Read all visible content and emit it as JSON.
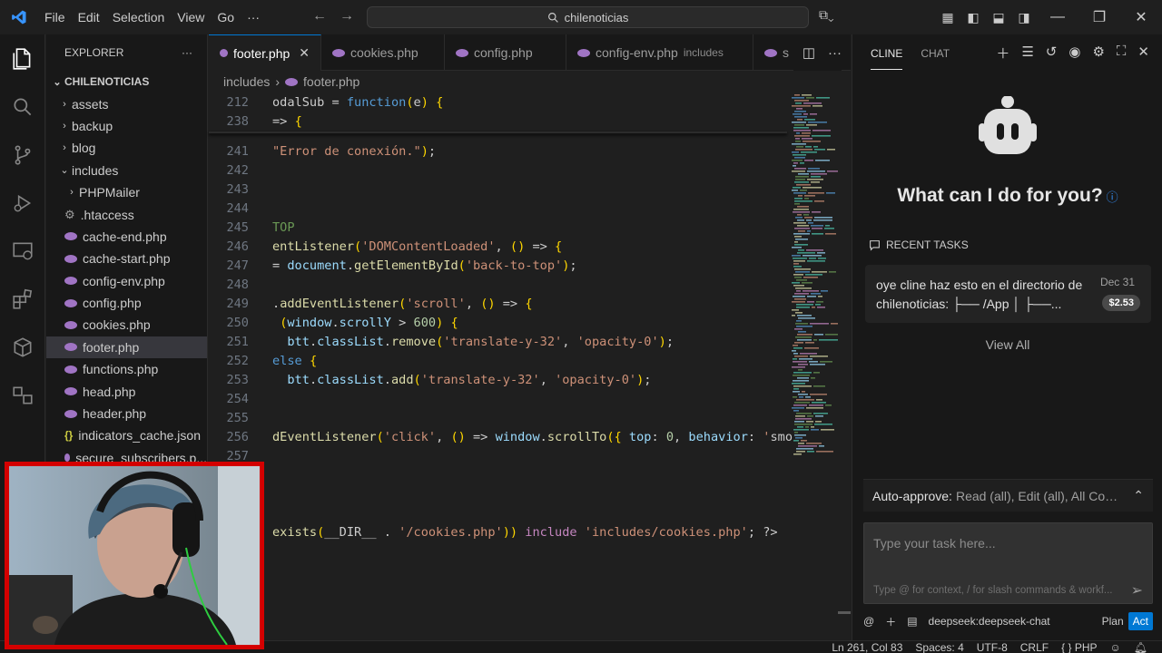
{
  "titlebar": {
    "menu": [
      "File",
      "Edit",
      "Selection",
      "View",
      "Go",
      "···"
    ],
    "search_text": "chilenoticias"
  },
  "explorer": {
    "title": "EXPLORER",
    "more": "···",
    "root": "CHILENOTICIAS",
    "items": [
      {
        "label": "assets",
        "type": "folder",
        "depth": 1,
        "open": false
      },
      {
        "label": "backup",
        "type": "folder",
        "depth": 1,
        "open": false
      },
      {
        "label": "blog",
        "type": "folder",
        "depth": 1,
        "open": false
      },
      {
        "label": "includes",
        "type": "folder",
        "depth": 1,
        "open": true
      },
      {
        "label": "PHPMailer",
        "type": "folder",
        "depth": 2,
        "open": false
      },
      {
        "label": ".htaccess",
        "type": "gear",
        "depth": 2
      },
      {
        "label": "cache-end.php",
        "type": "php",
        "depth": 2
      },
      {
        "label": "cache-start.php",
        "type": "php",
        "depth": 2
      },
      {
        "label": "config-env.php",
        "type": "php",
        "depth": 2
      },
      {
        "label": "config.php",
        "type": "php",
        "depth": 2
      },
      {
        "label": "cookies.php",
        "type": "php",
        "depth": 2
      },
      {
        "label": "footer.php",
        "type": "php",
        "depth": 2,
        "active": true
      },
      {
        "label": "functions.php",
        "type": "php",
        "depth": 2
      },
      {
        "label": "head.php",
        "type": "php",
        "depth": 2
      },
      {
        "label": "header.php",
        "type": "php",
        "depth": 2
      },
      {
        "label": "indicators_cache.json",
        "type": "json",
        "depth": 2
      },
      {
        "label": "secure_subscribers.p...",
        "type": "php",
        "depth": 2
      }
    ]
  },
  "editor": {
    "tabs": [
      {
        "label": "footer.php",
        "hint": "",
        "active": true,
        "close": "✕"
      },
      {
        "label": "cookies.php",
        "hint": "",
        "active": false
      },
      {
        "label": "config.php",
        "hint": "",
        "active": false
      },
      {
        "label": "config-env.php",
        "hint": "includes",
        "active": false
      },
      {
        "label": "s",
        "hint": "",
        "active": false
      }
    ],
    "breadcrumb": [
      "includes",
      "›",
      "footer.php"
    ],
    "sticky": [
      {
        "num": "212",
        "code": "odalSub = function(e) {"
      },
      {
        "num": "238",
        "code": "=> {"
      }
    ],
    "lines": [
      {
        "num": "241",
        "code": "\"Error de conexión.\");"
      },
      {
        "num": "242",
        "code": ""
      },
      {
        "num": "243",
        "code": ""
      },
      {
        "num": "244",
        "code": ""
      },
      {
        "num": "245",
        "code": "TOP"
      },
      {
        "num": "246",
        "code": "entListener('DOMContentLoaded', () => {"
      },
      {
        "num": "247",
        "code": "= document.getElementById('back-to-top');"
      },
      {
        "num": "248",
        "code": ""
      },
      {
        "num": "249",
        "code": ".addEventListener('scroll', () => {"
      },
      {
        "num": "250",
        "code": " (window.scrollY > 600) {"
      },
      {
        "num": "251",
        "code": "  btt.classList.remove('translate-y-32', 'opacity-0');"
      },
      {
        "num": "252",
        "code": "else {"
      },
      {
        "num": "253",
        "code": "  btt.classList.add('translate-y-32', 'opacity-0');"
      },
      {
        "num": "254",
        "code": ""
      },
      {
        "num": "255",
        "code": ""
      },
      {
        "num": "256",
        "code": "dEventListener('click', () => window.scrollTo({ top: 0, behavior: 'smo"
      },
      {
        "num": "257",
        "code": ""
      },
      {
        "num": "",
        "code": ""
      },
      {
        "num": "",
        "code": ""
      },
      {
        "num": "",
        "code": ""
      },
      {
        "num": "",
        "code": "exists(__DIR__ . '/cookies.php')) include 'includes/cookies.php'; ?>"
      }
    ]
  },
  "cline": {
    "tabs": [
      "CLINE",
      "CHAT"
    ],
    "heading": "What can I do for you?",
    "recent_title": "RECENT TASKS",
    "task": {
      "text": "oye cline haz esto en el directorio de chilenoticias: ├── /App │ ├──...",
      "date": "Dec 31",
      "cost": "$2.53"
    },
    "view_all": "View All",
    "auto_approve_label": "Auto-approve:",
    "auto_approve_value": "Read (all), Edit (all), All Comm...",
    "input_placeholder": "Type your task here...",
    "input_hint": "Type @ for context, / for slash commands & workf...",
    "model": "deepseek:deepseek-chat",
    "mode_plan": "Plan",
    "mode_act": "Act"
  },
  "status": {
    "position": "Ln 261, Col 83",
    "spaces": "Spaces: 4",
    "encoding": "UTF-8",
    "eol": "CRLF",
    "language": "PHP",
    "lang_braces": "{ }"
  },
  "colors": {
    "accent": "#0078d4",
    "php_icon": "#a074c4",
    "webcam_border": "#d40000"
  }
}
